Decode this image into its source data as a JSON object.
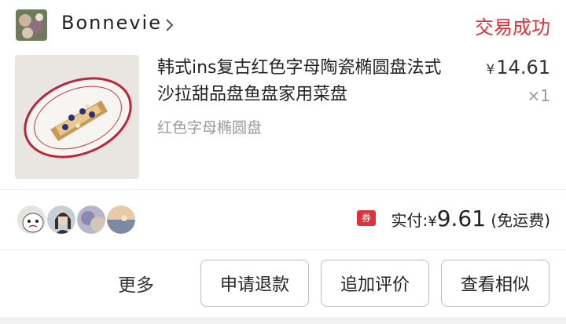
{
  "shop": {
    "name": "Bonnevie",
    "status": "交易成功"
  },
  "product": {
    "title": "韩式ins复古红色字母陶瓷椭圆盘法式沙拉甜品盘鱼盘家用菜盘",
    "spec": "红色字母椭圆盘",
    "price_symbol": "¥",
    "price": "14.61",
    "quantity": "×1"
  },
  "summary": {
    "coupon_icon": "券",
    "paid_label": "实付:",
    "paid_symbol": "¥",
    "paid_amount": "9.61",
    "shipping_note": "(免运费)"
  },
  "actions": {
    "more": "更多",
    "refund": "申请退款",
    "review": "追加评价",
    "similar": "查看相似"
  },
  "colors": {
    "status_red": "#e0323a",
    "muted_gray": "#9a9a9a"
  }
}
